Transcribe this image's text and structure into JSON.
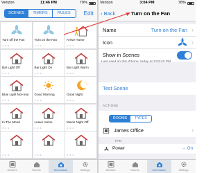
{
  "left": {
    "status": {
      "carrier": "Verizon",
      "time": "11:46 PM",
      "battery": "79%"
    },
    "segments": [
      "SCENES",
      "TIMERS",
      "RULES"
    ],
    "edit_label": "Edit",
    "tiles": [
      {
        "label": "Turn off the Fan",
        "icon": "fan-icon"
      },
      {
        "label": "Turn on the Fan",
        "icon": "fan-icon"
      },
      {
        "label": "Arrive Home",
        "icon": "arrive-home-icon"
      },
      {
        "label": "Bar Light Off",
        "icon": "house-icon"
      },
      {
        "label": "Bar Light On",
        "icon": "house-icon"
      },
      {
        "label": "Bar Light Warm",
        "icon": "house-icon"
      },
      {
        "label": "Blue Light Nor-mal",
        "icon": "house-icon"
      },
      {
        "label": "Good Morning",
        "icon": "sun-icon"
      },
      {
        "label": "Good Night",
        "icon": "moon-icon"
      },
      {
        "label": "In The Mood",
        "icon": "house-icon"
      },
      {
        "label": "Leave Home",
        "icon": "house-icon"
      },
      {
        "label": "Movie Night Off",
        "icon": "house-icon"
      },
      {
        "label": "",
        "icon": "house-icon"
      },
      {
        "label": "",
        "icon": "house-icon"
      },
      {
        "label": "",
        "icon": "house-icon"
      }
    ],
    "tabs": [
      {
        "label": "Devices",
        "icon": "devices-icon"
      },
      {
        "label": "Rooms",
        "icon": "rooms-icon"
      },
      {
        "label": "Automation",
        "icon": "automation-icon"
      },
      {
        "label": "Settings",
        "icon": "gear-icon"
      }
    ],
    "active_tab": 2
  },
  "right": {
    "status": {
      "carrier": "Verizon",
      "time": "3:04 PM",
      "battery": "78%"
    },
    "back_label": "Back",
    "title": "Turn on the Fan",
    "name_label": "Name",
    "name_value": "Turn on the Fan",
    "icon_label": "Icon",
    "show_label": "Show in Scenes",
    "last_used": "Last used on this iPhone: today at 3:03:40 PM",
    "test_scene": "Test Scene",
    "actions_header": "ACTIONS",
    "segments": [
      "ROOMS",
      "TYPES"
    ],
    "room": "James Office",
    "fan_header": "FAN",
    "power_label": "Power",
    "power_value": "On",
    "tabs": [
      {
        "label": "Devices",
        "icon": "devices-icon"
      },
      {
        "label": "Rooms",
        "icon": "rooms-icon"
      },
      {
        "label": "Automation",
        "icon": "automation-icon"
      },
      {
        "label": "Settings",
        "icon": "gear-icon"
      }
    ],
    "active_tab": 2
  },
  "colors": {
    "accent": "#2E7FD6",
    "annotation": "#E53935",
    "house_roof": "#C73A3A",
    "sun": "#F5A623"
  }
}
